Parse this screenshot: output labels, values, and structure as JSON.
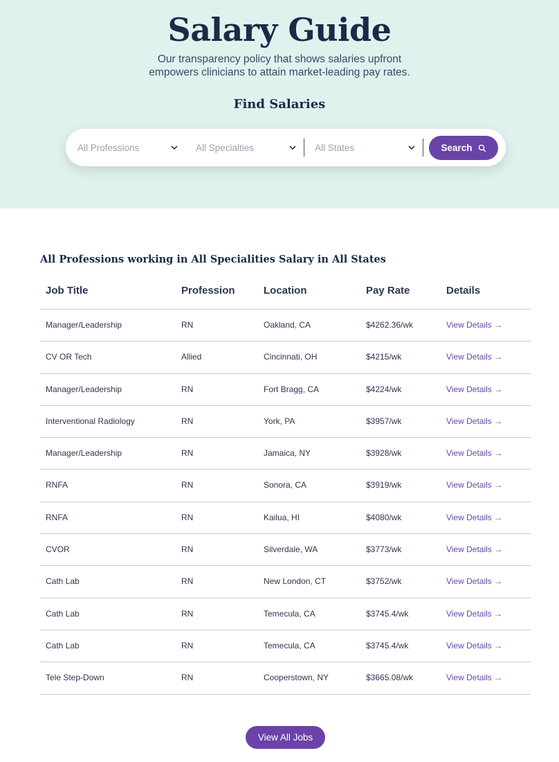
{
  "hero": {
    "title": "Salary Guide",
    "subtitle": "Our transparency policy that shows salaries upfront empowers clinicians to attain market-leading pay rates.",
    "find_title": "Find Salaries",
    "background": "#e0f2ee"
  },
  "search": {
    "profession_placeholder": "All Professions",
    "specialty_placeholder": "All Specialties",
    "state_placeholder": "All States",
    "button_label": "Search",
    "accent": "#6a43a8"
  },
  "results": {
    "heading": "All Professions working in All Specialities Salary in All States",
    "columns": [
      "Job Title",
      "Profession",
      "Location",
      "Pay Rate",
      "Details"
    ],
    "rows": [
      {
        "job": "Manager/Leadership",
        "profession": "RN",
        "location": "Oakland, CA",
        "pay": "$4262.36/wk",
        "details": "View Details →"
      },
      {
        "job": "CV OR Tech",
        "profession": "Allied",
        "location": "Cincinnati, OH",
        "pay": "$4215/wk",
        "details": "View Details →"
      },
      {
        "job": "Manager/Leadership",
        "profession": "RN",
        "location": "Fort Bragg, CA",
        "pay": "$4224/wk",
        "details": "View Details →"
      },
      {
        "job": "Interventional Radiology",
        "profession": "RN",
        "location": "York, PA",
        "pay": "$3957/wk",
        "details": "View Details →"
      },
      {
        "job": "Manager/Leadership",
        "profession": "RN",
        "location": "Jamaica, NY",
        "pay": "$3928/wk",
        "details": "View Details →"
      },
      {
        "job": "RNFA",
        "profession": "RN",
        "location": "Sonora, CA",
        "pay": "$3919/wk",
        "details": "View Details →"
      },
      {
        "job": "RNFA",
        "profession": "RN",
        "location": "Kailua, HI",
        "pay": "$4080/wk",
        "details": "View Details →"
      },
      {
        "job": "CVOR",
        "profession": "RN",
        "location": "Silverdale, WA",
        "pay": "$3773/wk",
        "details": "View Details →"
      },
      {
        "job": "Cath Lab",
        "profession": "RN",
        "location": "New London, CT",
        "pay": "$3752/wk",
        "details": "View Details →"
      },
      {
        "job": "Cath Lab",
        "profession": "RN",
        "location": "Temecula, CA",
        "pay": "$3745.4/wk",
        "details": "View Details →"
      },
      {
        "job": "Cath Lab",
        "profession": "RN",
        "location": "Temecula, CA",
        "pay": "$3745.4/wk",
        "details": "View Details →"
      },
      {
        "job": "Tele Step-Down",
        "profession": "RN",
        "location": "Cooperstown, NY",
        "pay": "$3665.08/wk",
        "details": "View Details →"
      }
    ],
    "view_all_label": "View All Jobs"
  }
}
